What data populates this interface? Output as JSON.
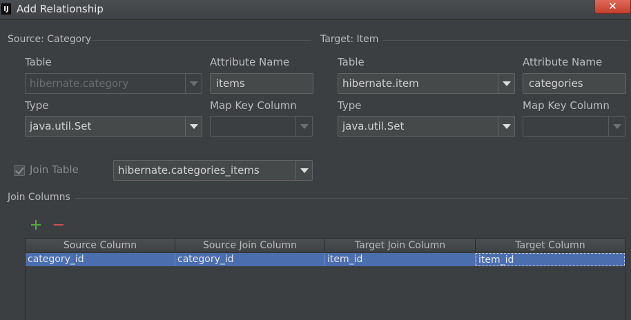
{
  "window": {
    "title": "Add Relationship",
    "app_icon": "IJ",
    "close_glyph": "✕"
  },
  "source": {
    "section_title": "Source: Category",
    "table_label": "Table",
    "table_value": "hibernate.category",
    "attribute_label": "Attribute Name",
    "attribute_value": "items",
    "type_label": "Type",
    "type_value": "java.util.Set",
    "map_key_label": "Map Key Column",
    "map_key_value": ""
  },
  "target": {
    "section_title": "Target: Item",
    "table_label": "Table",
    "table_value": "hibernate.item",
    "attribute_label": "Attribute Name",
    "attribute_value": "categories",
    "type_label": "Type",
    "type_value": "java.util.Set",
    "map_key_label": "Map Key Column",
    "map_key_value": ""
  },
  "join_table": {
    "label": "Join Table",
    "checked": true,
    "enabled": false,
    "value": "hibernate.categories_items"
  },
  "join_columns": {
    "section_title": "Join Columns",
    "add_icon": "plus-icon",
    "remove_icon": "minus-icon",
    "columns": [
      "Source Column",
      "Source Join Column",
      "Target Join Column",
      "Target Column"
    ],
    "rows": [
      [
        "category_id",
        "category_id",
        "item_id",
        "item_id"
      ]
    ]
  },
  "colors": {
    "background": "#3c3f41",
    "selection": "#4b6eaf",
    "add": "#4caf3a",
    "remove": "#c75450",
    "close": "#c4402f"
  }
}
